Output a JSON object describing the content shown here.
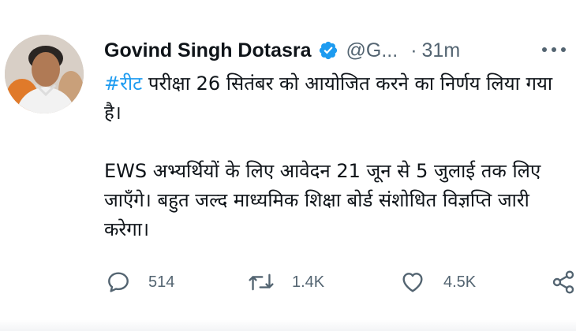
{
  "tweet": {
    "author_name": "Govind Singh Dotasra",
    "handle": "@G...",
    "separator": "·",
    "time": "31m",
    "hashtag": "#रीट",
    "line1_rest": " परीक्षा 26 सितंबर को आयोजित करने का निर्णय लिया गया है।",
    "paragraph2": "EWS अभ्यर्थियों के लिए आवेदन 21 जून से 5 जुलाई तक लिए जाएँगे। बहुत जल्द माध्यमिक शिक्षा बोर्ड संशोधित विज्ञप्ति जारी करेगा।",
    "actions": {
      "replies": "514",
      "retweets": "1.4K",
      "likes": "4.5K"
    }
  },
  "colors": {
    "hashtag": "#1d9bf0",
    "verified": "#1d9bf0",
    "muted": "#536471",
    "text": "#0f1419"
  },
  "icons": [
    "verified-badge-icon",
    "more-icon",
    "reply-icon",
    "retweet-icon",
    "like-icon",
    "share-icon"
  ]
}
